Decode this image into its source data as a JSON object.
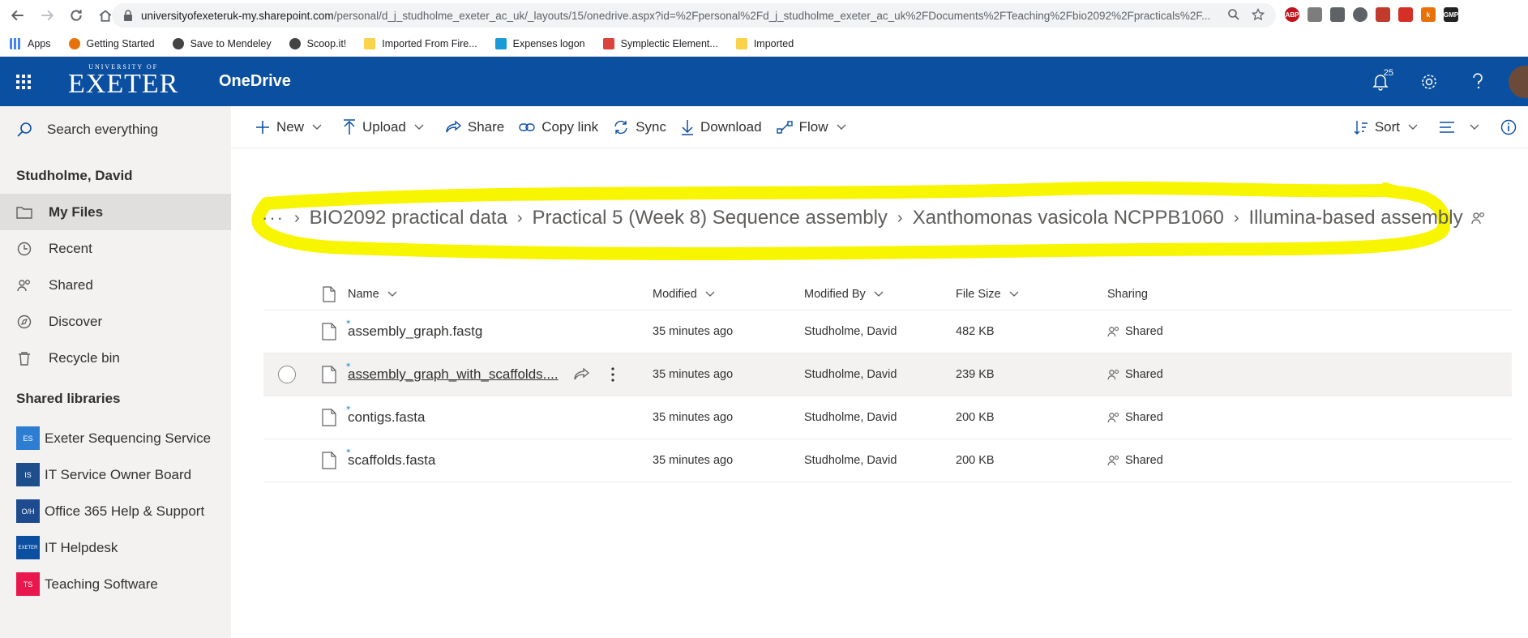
{
  "browser": {
    "url_host": "universityofexeteruk-my.sharepoint.com",
    "url_rest": "/personal/d_j_studholme_exeter_ac_uk/_layouts/15/onedrive.aspx?id=%2Fpersonal%2Fd_j_studholme_exeter_ac_uk%2FDocuments%2FTeaching%2Fbio2092%2Fpracticals%2F...",
    "bookmarks": [
      {
        "label": "Apps",
        "color": "#4285f4"
      },
      {
        "label": "Getting Started",
        "color": "#e8710a"
      },
      {
        "label": "Save to Mendeley",
        "color": "#444444"
      },
      {
        "label": "Scoop.it!",
        "color": "#444444"
      },
      {
        "label": "Imported From Fire...",
        "color": "#f9d34a"
      },
      {
        "label": "Expenses logon",
        "color": "#1a9bd7"
      },
      {
        "label": "Symplectic Element...",
        "color": "#d9453c"
      },
      {
        "label": "Imported",
        "color": "#f9d34a"
      }
    ],
    "extensions": [
      {
        "label": "ABP",
        "color": "#c3121b"
      },
      {
        "label": "",
        "color": "#7d7d7d"
      },
      {
        "label": "",
        "color": "#5f6368"
      },
      {
        "label": "",
        "color": "#5f6368"
      },
      {
        "label": "",
        "color": "#c23a2b"
      },
      {
        "label": "",
        "color": "#d63026"
      },
      {
        "label": "k",
        "color": "#e8710a"
      },
      {
        "label": "GMP",
        "color": "#222222"
      }
    ]
  },
  "suitebar": {
    "brand_small": "UNIVERSITY OF",
    "brand_big": "EXETER",
    "app_name": "OneDrive",
    "notification_count": "25"
  },
  "leftnav": {
    "search_placeholder": "Search everything",
    "owner": "Studholme, David",
    "items": [
      {
        "label": "My Files",
        "icon": "folder-icon",
        "active": true
      },
      {
        "label": "Recent",
        "icon": "clock-icon",
        "active": false
      },
      {
        "label": "Shared",
        "icon": "people-icon",
        "active": false
      },
      {
        "label": "Discover",
        "icon": "compass-icon",
        "active": false
      },
      {
        "label": "Recycle bin",
        "icon": "trash-icon",
        "active": false
      }
    ],
    "libraries_header": "Shared libraries",
    "libraries": [
      {
        "label": "Exeter Sequencing Service",
        "badge": "ES",
        "color": "#2d7dd2"
      },
      {
        "label": "IT Service Owner Board",
        "badge": "IS",
        "color": "#1f4e8c"
      },
      {
        "label": "Office 365 Help & Support",
        "badge": "O/H",
        "color": "#1e4b8f"
      },
      {
        "label": "IT Helpdesk",
        "badge": "EXETER",
        "color": "#0b4fa0"
      },
      {
        "label": "Teaching Software",
        "badge": "TS",
        "color": "#e8174d"
      }
    ]
  },
  "commands": {
    "new": "New",
    "upload": "Upload",
    "share": "Share",
    "copy_link": "Copy link",
    "sync": "Sync",
    "download": "Download",
    "flow": "Flow",
    "sort": "Sort"
  },
  "breadcrumb": {
    "overflow": "···",
    "items": [
      "BIO2092 practical data",
      "Practical 5 (Week 8) Sequence assembly",
      "Xanthomonas vasicola NCPPB1060",
      "Illumina-based assembly"
    ],
    "highlight_color": "#f7f500"
  },
  "table": {
    "headers": {
      "name": "Name",
      "modified": "Modified",
      "modified_by": "Modified By",
      "file_size": "File Size",
      "sharing": "Sharing"
    },
    "rows": [
      {
        "name": "assembly_graph.fastg",
        "modified": "35 minutes ago",
        "modified_by": "Studholme, David",
        "size": "482 KB",
        "sharing": "Shared"
      },
      {
        "name": "assembly_graph_with_scaffolds....",
        "modified": "35 minutes ago",
        "modified_by": "Studholme, David",
        "size": "239 KB",
        "sharing": "Shared"
      },
      {
        "name": "contigs.fasta",
        "modified": "35 minutes ago",
        "modified_by": "Studholme, David",
        "size": "200 KB",
        "sharing": "Shared"
      },
      {
        "name": "scaffolds.fasta",
        "modified": "35 minutes ago",
        "modified_by": "Studholme, David",
        "size": "200 KB",
        "sharing": "Shared"
      }
    ]
  }
}
